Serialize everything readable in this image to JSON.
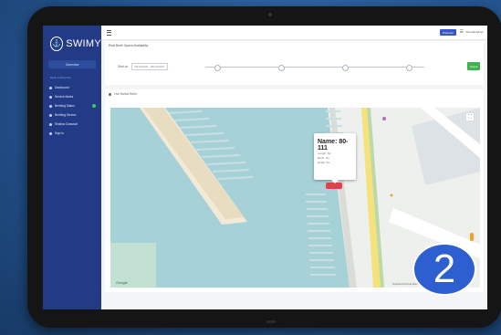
{
  "app": {
    "logo_text": "SWIMY"
  },
  "sidebar": {
    "primary_button": "Overview",
    "section_label": "Berth Listing Info",
    "items": [
      {
        "label": "Dashboard"
      },
      {
        "label": "Service Marks"
      },
      {
        "label": "Berthing Status",
        "status": "green"
      },
      {
        "label": "Berthing Service"
      },
      {
        "label": "Shallow Classical"
      },
      {
        "label": "Sign In"
      }
    ]
  },
  "topbar": {
    "badge": "Premium",
    "user": "Vanshal Admin"
  },
  "filter": {
    "title": "Real Berth Space Availability",
    "date_label": "Start on",
    "date_value": "08/12/2020 - 09/12/2020",
    "go_label": "Check"
  },
  "map": {
    "header": "Live Harbor Berth",
    "popup": {
      "title": "Name: 80-111",
      "lines": [
        "Length: 8m",
        "Berth: 3m",
        "Depth: 3m"
      ]
    },
    "google": "Google",
    "attribution": "Keyboard shortcuts  Map data ©2020  Terms of Use"
  },
  "step_badge": "2",
  "colors": {
    "sidebar": "#233b86",
    "accent": "#3a57c4",
    "go": "#3eb34f",
    "water": "#a6d1d6",
    "boat": "#e04050",
    "step": "#2d5fd0"
  }
}
